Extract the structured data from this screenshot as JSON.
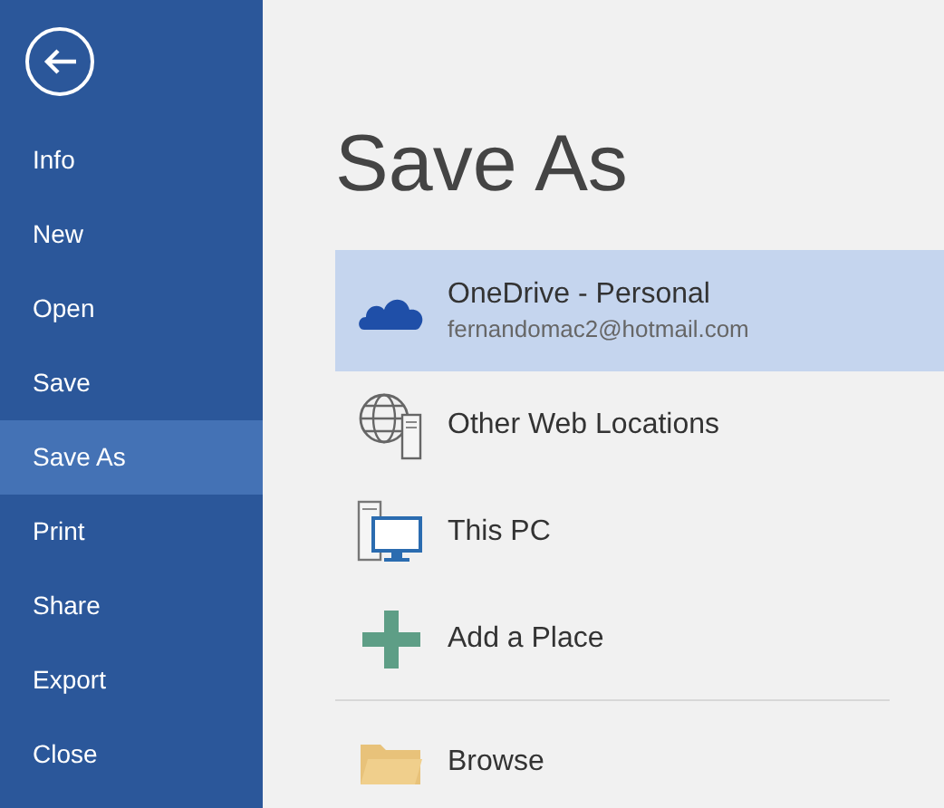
{
  "sidebar": {
    "items": [
      {
        "label": "Info",
        "selected": false
      },
      {
        "label": "New",
        "selected": false
      },
      {
        "label": "Open",
        "selected": false
      },
      {
        "label": "Save",
        "selected": false
      },
      {
        "label": "Save As",
        "selected": true
      },
      {
        "label": "Print",
        "selected": false
      },
      {
        "label": "Share",
        "selected": false
      },
      {
        "label": "Export",
        "selected": false
      },
      {
        "label": "Close",
        "selected": false
      }
    ]
  },
  "page": {
    "title": "Save As"
  },
  "places": [
    {
      "kind": "cloud",
      "label": "OneDrive - Personal",
      "detail": "fernandomac2@hotmail.com",
      "selected": true
    },
    {
      "kind": "globe",
      "label": "Other Web Locations",
      "selected": false
    },
    {
      "kind": "pc",
      "label": "This PC",
      "selected": false
    },
    {
      "kind": "add",
      "label": "Add a Place",
      "selected": false
    },
    {
      "kind": "folder",
      "label": "Browse",
      "selected": false
    }
  ]
}
